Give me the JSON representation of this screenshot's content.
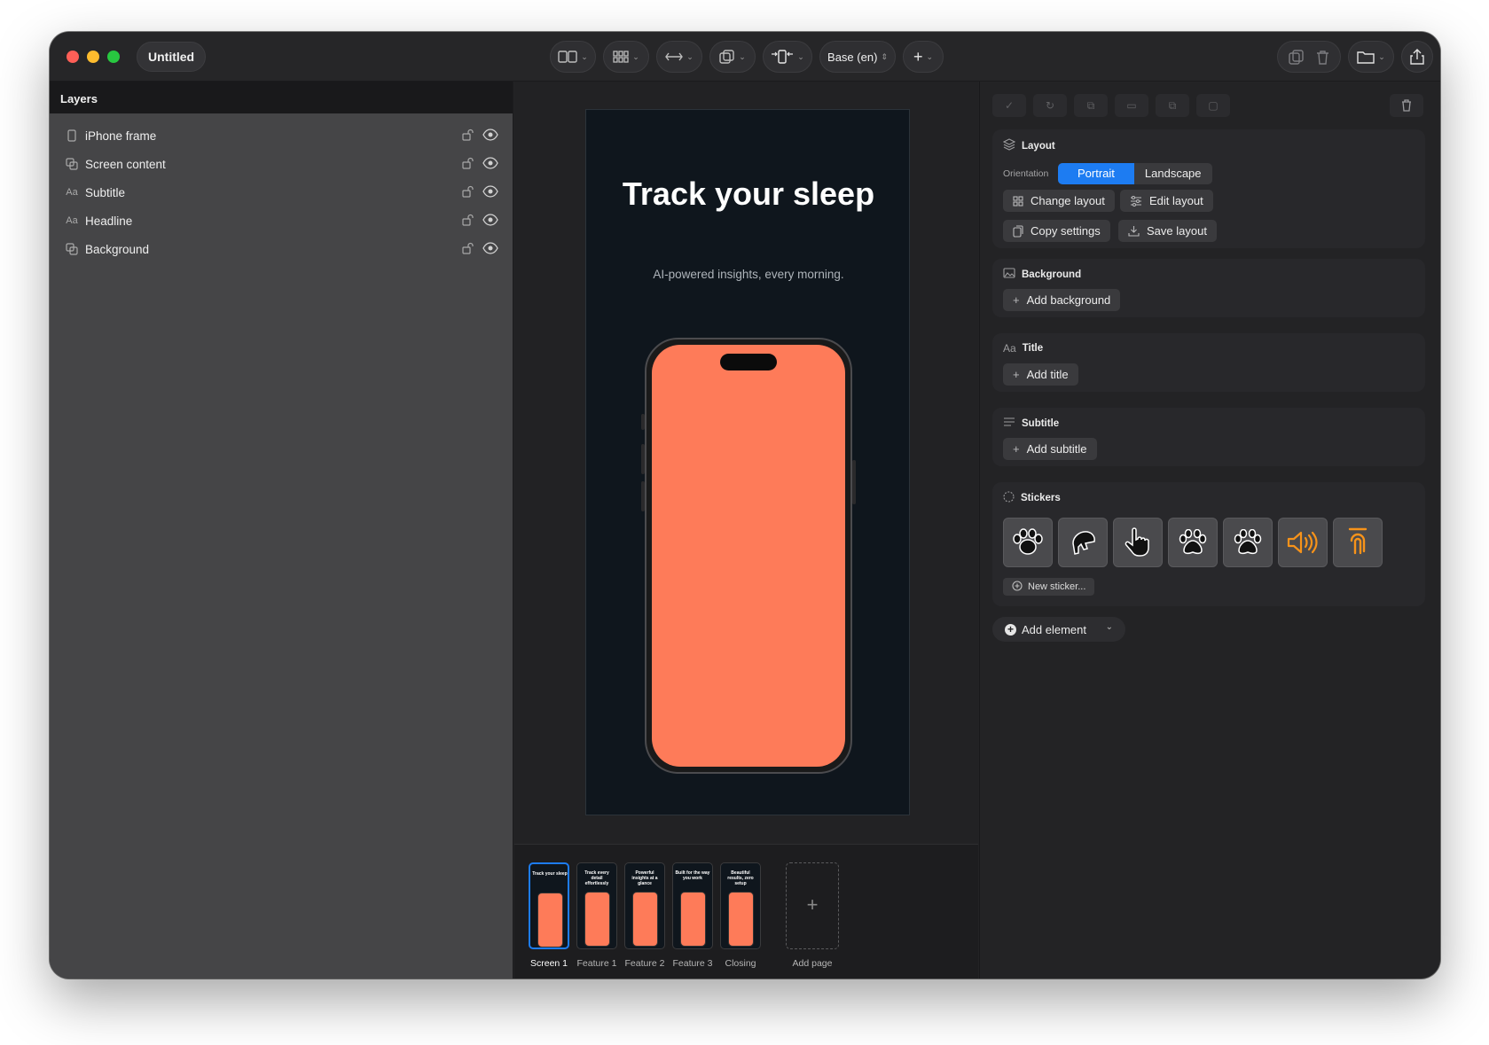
{
  "window": {
    "title": "Untitled"
  },
  "toolbar": {
    "language": "Base (en)"
  },
  "layers": {
    "header": "Layers",
    "items": [
      {
        "label": "iPhone frame",
        "icon": "phone-icon"
      },
      {
        "label": "Screen content",
        "icon": "layers-icon"
      },
      {
        "label": "Subtitle",
        "icon": "text-icon"
      },
      {
        "label": "Headline",
        "icon": "text-icon"
      },
      {
        "label": "Background",
        "icon": "layers-icon"
      }
    ]
  },
  "canvas": {
    "headline": "Track your sleep",
    "subtitle": "AI-powered insights, every morning.",
    "screen_color": "#fe7b59",
    "background_color": "#0f161d"
  },
  "pages": {
    "items": [
      {
        "label": "Screen 1",
        "thumb_title": "Track your sleep",
        "selected": true
      },
      {
        "label": "Feature 1",
        "thumb_title": "Track every detail effortlessly"
      },
      {
        "label": "Feature 2",
        "thumb_title": "Powerful insights at a glance"
      },
      {
        "label": "Feature 3",
        "thumb_title": "Built for the way you work"
      },
      {
        "label": "Closing",
        "thumb_title": "Beautiful results, zero setup"
      }
    ],
    "add_label": "Add page",
    "add_symbol": "+"
  },
  "inspector": {
    "layout": {
      "title": "Layout",
      "orientation_label": "Orientation",
      "portrait": "Portrait",
      "landscape": "Landscape",
      "selected_orientation": "Portrait",
      "change_layout": "Change layout",
      "edit_layout": "Edit layout",
      "copy_settings": "Copy settings",
      "save_layout": "Save layout"
    },
    "background": {
      "title": "Background",
      "add": "Add background"
    },
    "title_section": {
      "title": "Title",
      "add": "Add title"
    },
    "subtitle": {
      "title": "Subtitle",
      "add": "Add subtitle"
    },
    "stickers": {
      "title": "Stickers",
      "items": [
        "paw-print-icon",
        "pointing-hand-icon",
        "hand-cursor-icon",
        "paw-icon",
        "paw-icon-alt",
        "speaker-icon",
        "touch-icon"
      ],
      "new_sticker": "New sticker..."
    },
    "add_element": "Add element",
    "accent_color": "#1d7cf2",
    "sticker_orange": "#f7931a"
  }
}
